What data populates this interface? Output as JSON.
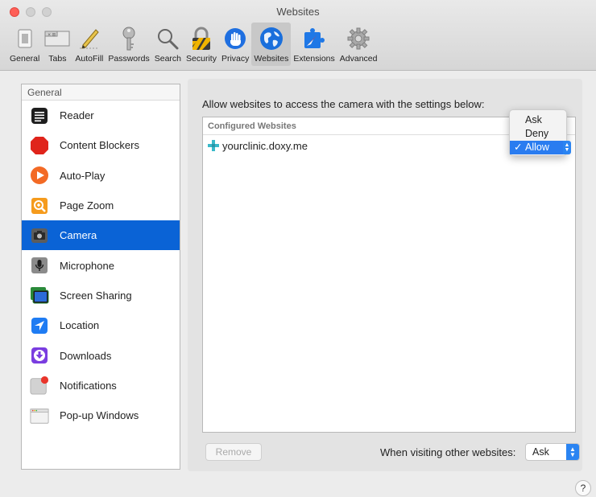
{
  "window": {
    "title": "Websites"
  },
  "toolbar": {
    "items": [
      {
        "label": "General",
        "icon": "general-icon"
      },
      {
        "label": "Tabs",
        "icon": "tabs-icon"
      },
      {
        "label": "AutoFill",
        "icon": "autofill-pencil-icon"
      },
      {
        "label": "Passwords",
        "icon": "key-icon"
      },
      {
        "label": "Search",
        "icon": "magnifier-icon"
      },
      {
        "label": "Security",
        "icon": "padlock-icon"
      },
      {
        "label": "Privacy",
        "icon": "hand-icon"
      },
      {
        "label": "Websites",
        "icon": "globe-icon",
        "active": true
      },
      {
        "label": "Extensions",
        "icon": "puzzle-icon"
      },
      {
        "label": "Advanced",
        "icon": "gear-icon"
      }
    ]
  },
  "sidebar": {
    "header": "General",
    "items": [
      {
        "label": "Reader",
        "icon": "reader-icon"
      },
      {
        "label": "Content Blockers",
        "icon": "stop-sign-icon"
      },
      {
        "label": "Auto-Play",
        "icon": "play-icon"
      },
      {
        "label": "Page Zoom",
        "icon": "zoom-icon"
      },
      {
        "label": "Camera",
        "icon": "camera-icon",
        "selected": true
      },
      {
        "label": "Microphone",
        "icon": "microphone-icon"
      },
      {
        "label": "Screen Sharing",
        "icon": "screen-sharing-icon"
      },
      {
        "label": "Location",
        "icon": "location-arrow-icon"
      },
      {
        "label": "Downloads",
        "icon": "download-icon"
      },
      {
        "label": "Notifications",
        "icon": "notification-badge-icon"
      },
      {
        "label": "Pop-up Windows",
        "icon": "popup-window-icon"
      }
    ]
  },
  "main": {
    "prompt": "Allow websites to access the camera with the settings below:",
    "table_header": "Configured Websites",
    "websites": [
      {
        "name": "yourclinic.doxy.me",
        "setting": "Allow"
      }
    ],
    "popup_options": [
      "Ask",
      "Deny",
      "Allow"
    ],
    "popup_selected": "Allow",
    "remove_label": "Remove",
    "other_label": "When visiting other websites:",
    "other_value": "Ask"
  },
  "help_label": "?",
  "colors": {
    "accent": "#0a63d6",
    "close": "#fe5f57"
  }
}
